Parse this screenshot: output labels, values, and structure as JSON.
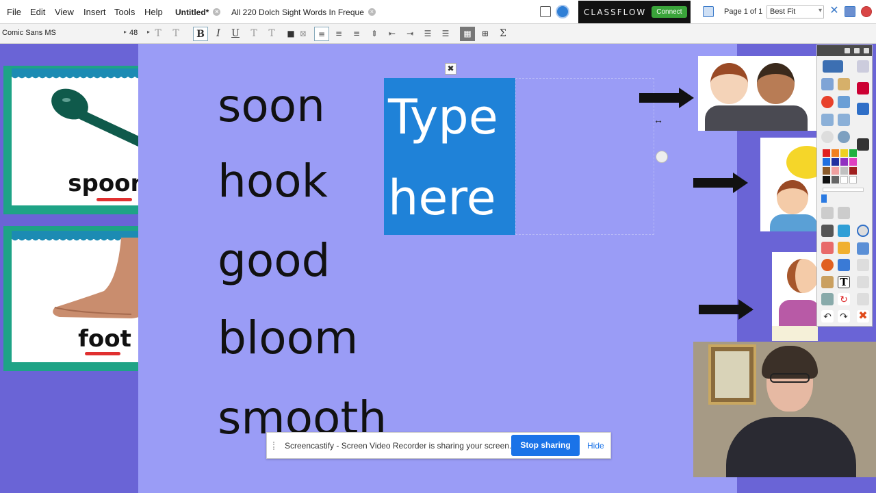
{
  "menu": [
    "File",
    "Edit",
    "View",
    "Insert",
    "Tools",
    "Help"
  ],
  "tabs": [
    {
      "label": "Untitled*",
      "active": true
    },
    {
      "label": "All 220 Dolch Sight Words In Freque",
      "active": false
    }
  ],
  "classflow": {
    "logo": "CLASSFLOW",
    "connect_label": "Connect"
  },
  "page_indicator": "Page 1 of 1",
  "zoom": "Best Fit",
  "format": {
    "font": "Comic Sans MS",
    "size": "48"
  },
  "cards": [
    {
      "word": "spoon",
      "picture": "spoon-illustration"
    },
    {
      "word": "foot",
      "picture": "foot-photo"
    }
  ],
  "words": [
    "soon",
    "hook",
    "good",
    "bloom",
    "smooth"
  ],
  "textbox": {
    "line1": "Type",
    "line2": "here"
  },
  "colors": {
    "canvas": "#9a9cf6",
    "page_margin": "#6a64d6",
    "card_border": "#1ea386",
    "textbox": "#1f82d8"
  },
  "share_bar": {
    "message": "Screencastify - Screen Video Recorder is sharing your screen.",
    "stop_label": "Stop sharing",
    "hide_label": "Hide"
  }
}
